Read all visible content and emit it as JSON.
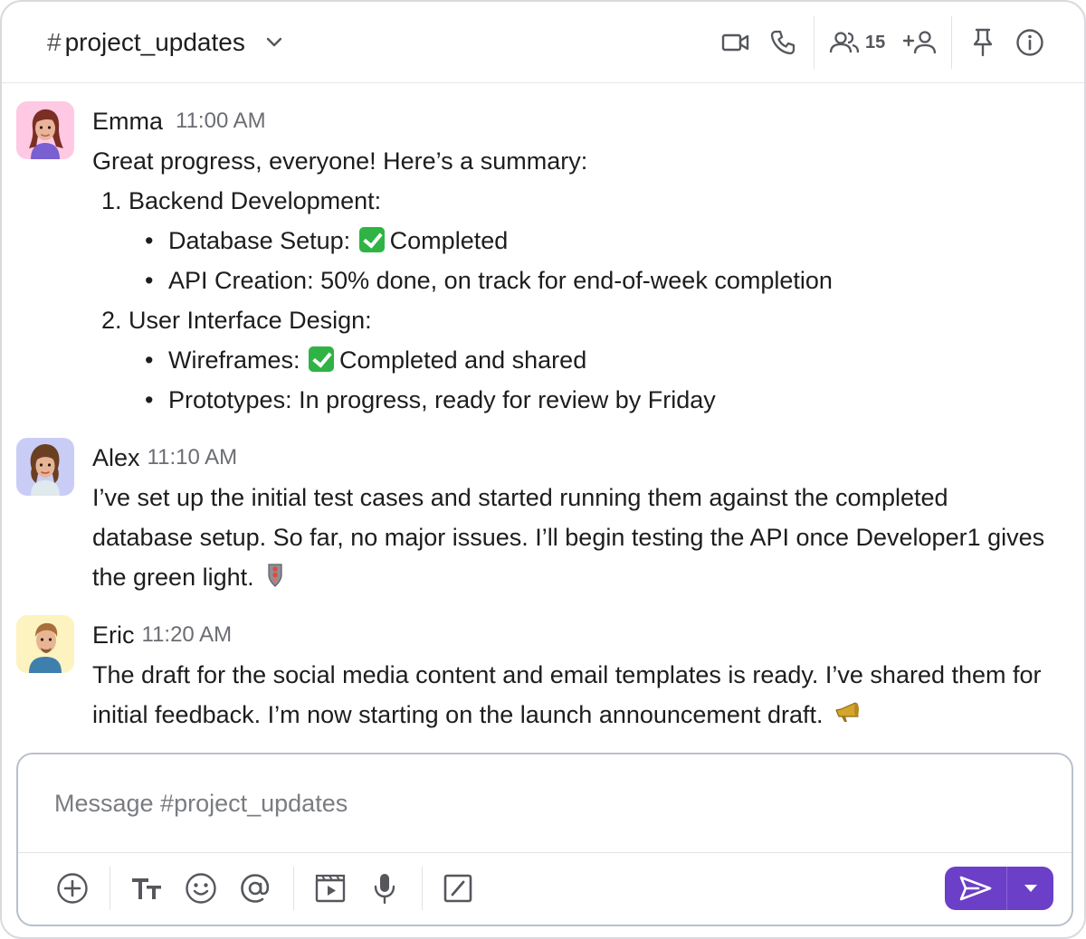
{
  "header": {
    "hash": "#",
    "channel_name": "project_updates",
    "member_count": "15",
    "icons": [
      "video-icon",
      "phone-icon",
      "members-icon",
      "add-member-icon",
      "pin-icon",
      "info-icon"
    ]
  },
  "messages": [
    {
      "author": "Emma",
      "time": "11:00 AM",
      "avatar_bg": "#ffc9e3",
      "lines": {
        "intro": "Great progress, everyone! Here’s a summary:",
        "item1": "1. Backend Development:",
        "item1_a_label": "Database Setup:",
        "item1_a_rest": "Completed",
        "item1_b": "API Creation: 50% done, on track for end-of-week completion",
        "item2": "2. User Interface Design:",
        "item2_a_label": "Wireframes:",
        "item2_a_rest": "Completed and shared",
        "item2_b": "Prototypes: In progress, ready for review by Friday"
      }
    },
    {
      "author": "Alex",
      "time": "11:10 AM",
      "avatar_bg": "#c9cdf6",
      "lines": {
        "l1": "I’ve set up the initial test cases and started running them against the completed",
        "l2": "database setup. So far, no major issues. I’ll begin testing the API once Developer1 gives",
        "l3": "the green light."
      }
    },
    {
      "author": "Eric",
      "time": "11:20 AM",
      "avatar_bg": "#fdf3c0",
      "lines": {
        "l1": "The draft for the social media content and email templates is ready. I’ve shared them for",
        "l2": "initial feedback. I’m now starting on the launch announcement draft."
      }
    }
  ],
  "bullet": "•",
  "composer": {
    "placeholder": "Message #project_updates",
    "toolbar_icons": [
      "add-icon",
      "text-format-icon",
      "emoji-icon",
      "mention-icon",
      "video-clip-icon",
      "microphone-icon",
      "slash-command-icon"
    ],
    "send_color": "#6b3fc7"
  }
}
